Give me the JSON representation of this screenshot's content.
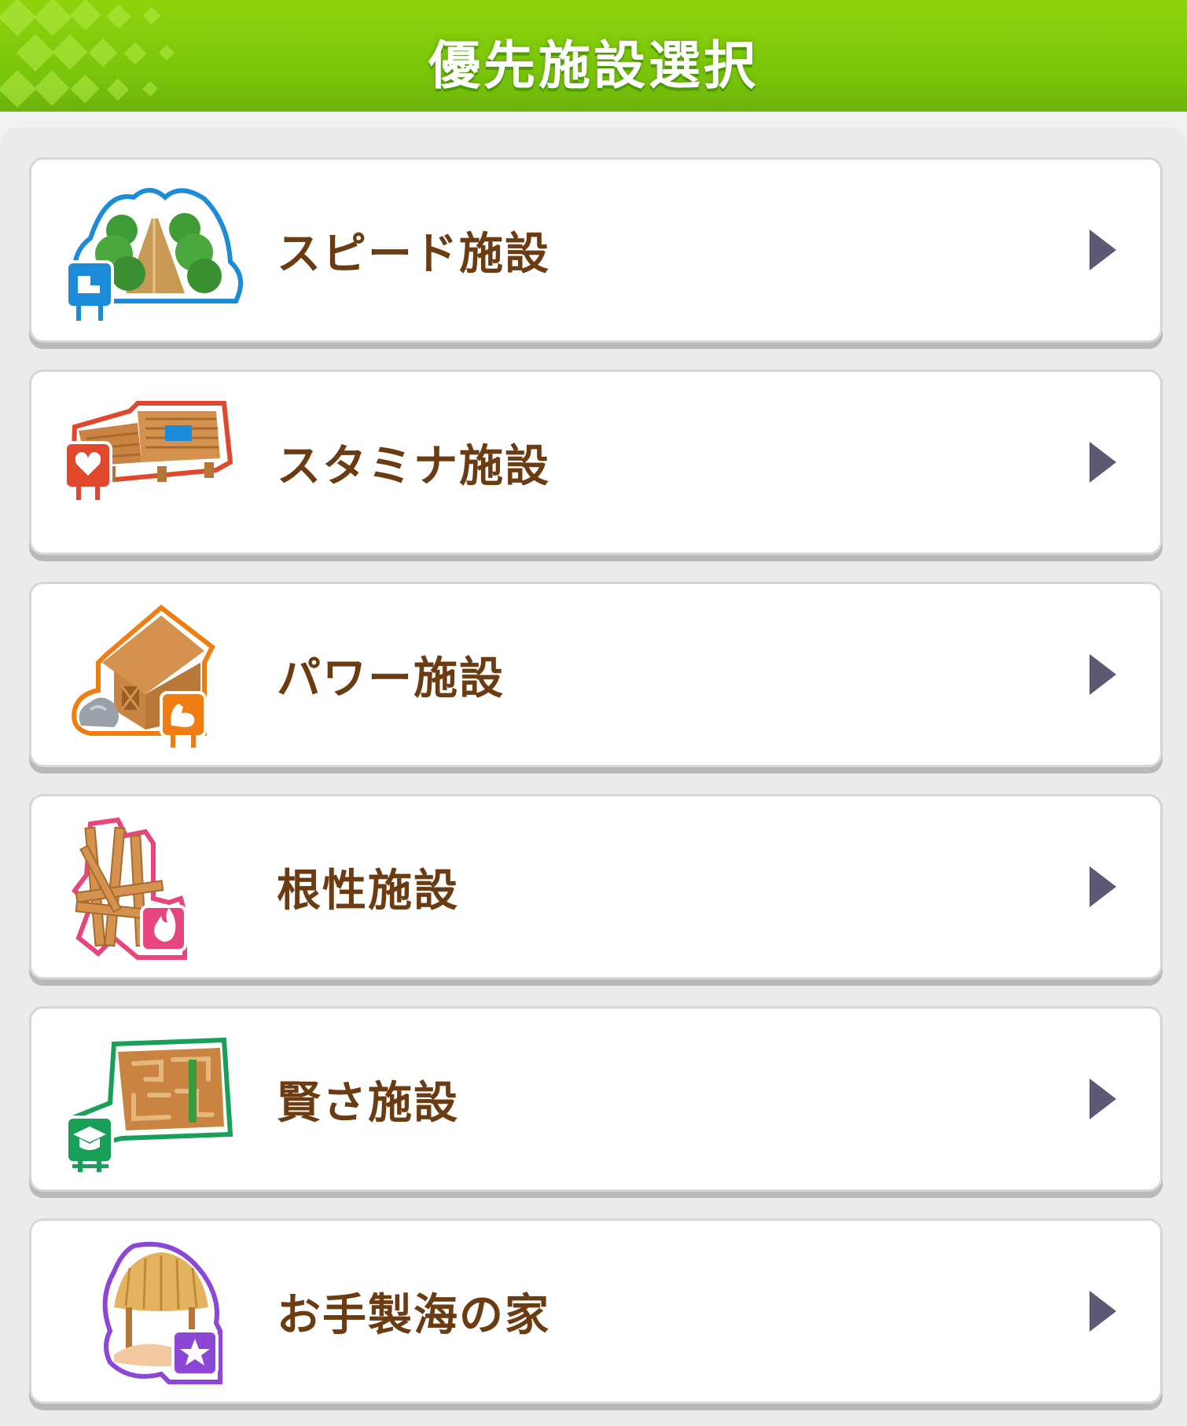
{
  "header": {
    "title": "優先施設選択"
  },
  "items": [
    {
      "label": "スピード施設",
      "icon": "speed-facility-icon",
      "color": "#1c8bd8"
    },
    {
      "label": "スタミナ施設",
      "icon": "stamina-facility-icon",
      "color": "#e0472d"
    },
    {
      "label": "パワー施設",
      "icon": "power-facility-icon",
      "color": "#f07d12"
    },
    {
      "label": "根性施設",
      "icon": "guts-facility-icon",
      "color": "#e8457f"
    },
    {
      "label": "賢さ施設",
      "icon": "wisdom-facility-icon",
      "color": "#18a058"
    },
    {
      "label": "お手製海の家",
      "icon": "beach-house-icon",
      "color": "#8c47d6"
    }
  ],
  "colors": {
    "header": "#80c80c",
    "label": "#6b3b12",
    "arrow": "#5d5874"
  }
}
